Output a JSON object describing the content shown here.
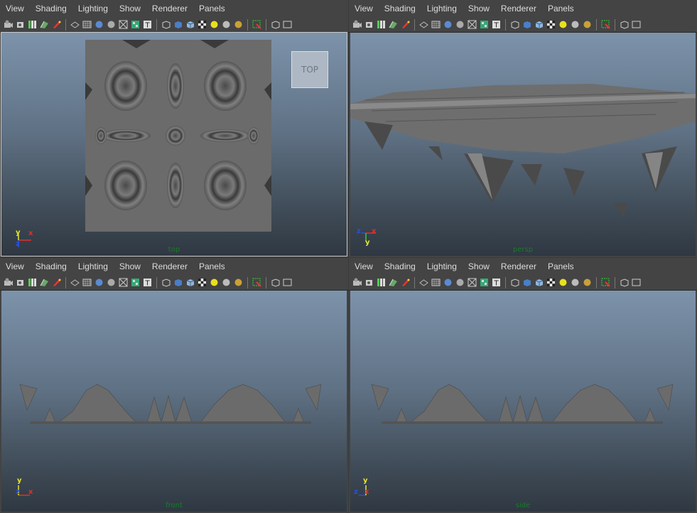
{
  "panels": [
    {
      "id": "top",
      "menu": [
        "View",
        "Shading",
        "Lighting",
        "Show",
        "Renderer",
        "Panels"
      ],
      "camera_label": "top",
      "viewcube_label": "TOP",
      "axes": {
        "a": "y",
        "b": "x",
        "c": "z"
      }
    },
    {
      "id": "persp",
      "menu": [
        "View",
        "Shading",
        "Lighting",
        "Show",
        "Renderer",
        "Panels"
      ],
      "camera_label": "persp",
      "axes": {
        "a": "z",
        "b": "x",
        "c": "y"
      }
    },
    {
      "id": "front",
      "menu": [
        "View",
        "Shading",
        "Lighting",
        "Show",
        "Renderer",
        "Panels"
      ],
      "camera_label": "front",
      "axes": {
        "a": "y",
        "b": "x",
        "c": "z"
      }
    },
    {
      "id": "side",
      "menu": [
        "View",
        "Shading",
        "Lighting",
        "Show",
        "Renderer",
        "Panels"
      ],
      "camera_label": "side",
      "axes": {
        "a": "y",
        "b": "x",
        "c": "z"
      }
    }
  ],
  "colors": {
    "axis_x": "#e0302a",
    "axis_y": "#e8e82a",
    "axis_z": "#2a4fe0",
    "mesh": "#6b6b6b",
    "mesh_dark": "#3f3f3f",
    "camera_label": "#1a7a2a"
  },
  "toolbar_icons": [
    "camera-select-icon",
    "camera-attributes-icon",
    "bookmark-icon",
    "image-plane-icon",
    "grease-pencil-icon",
    "sep",
    "wireframe-icon",
    "grid-icon",
    "smooth-shade-icon",
    "flat-shade-icon",
    "xray-icon",
    "textured-icon",
    "text-icon",
    "sep",
    "bounding-box-icon",
    "shaded-cube-icon",
    "lit-cube-icon",
    "checker-icon",
    "light-yellow-icon",
    "light-grey-icon",
    "light-gold-icon",
    "sep",
    "isolate-select-icon",
    "sep",
    "resolution-gate-icon",
    "film-gate-icon"
  ]
}
